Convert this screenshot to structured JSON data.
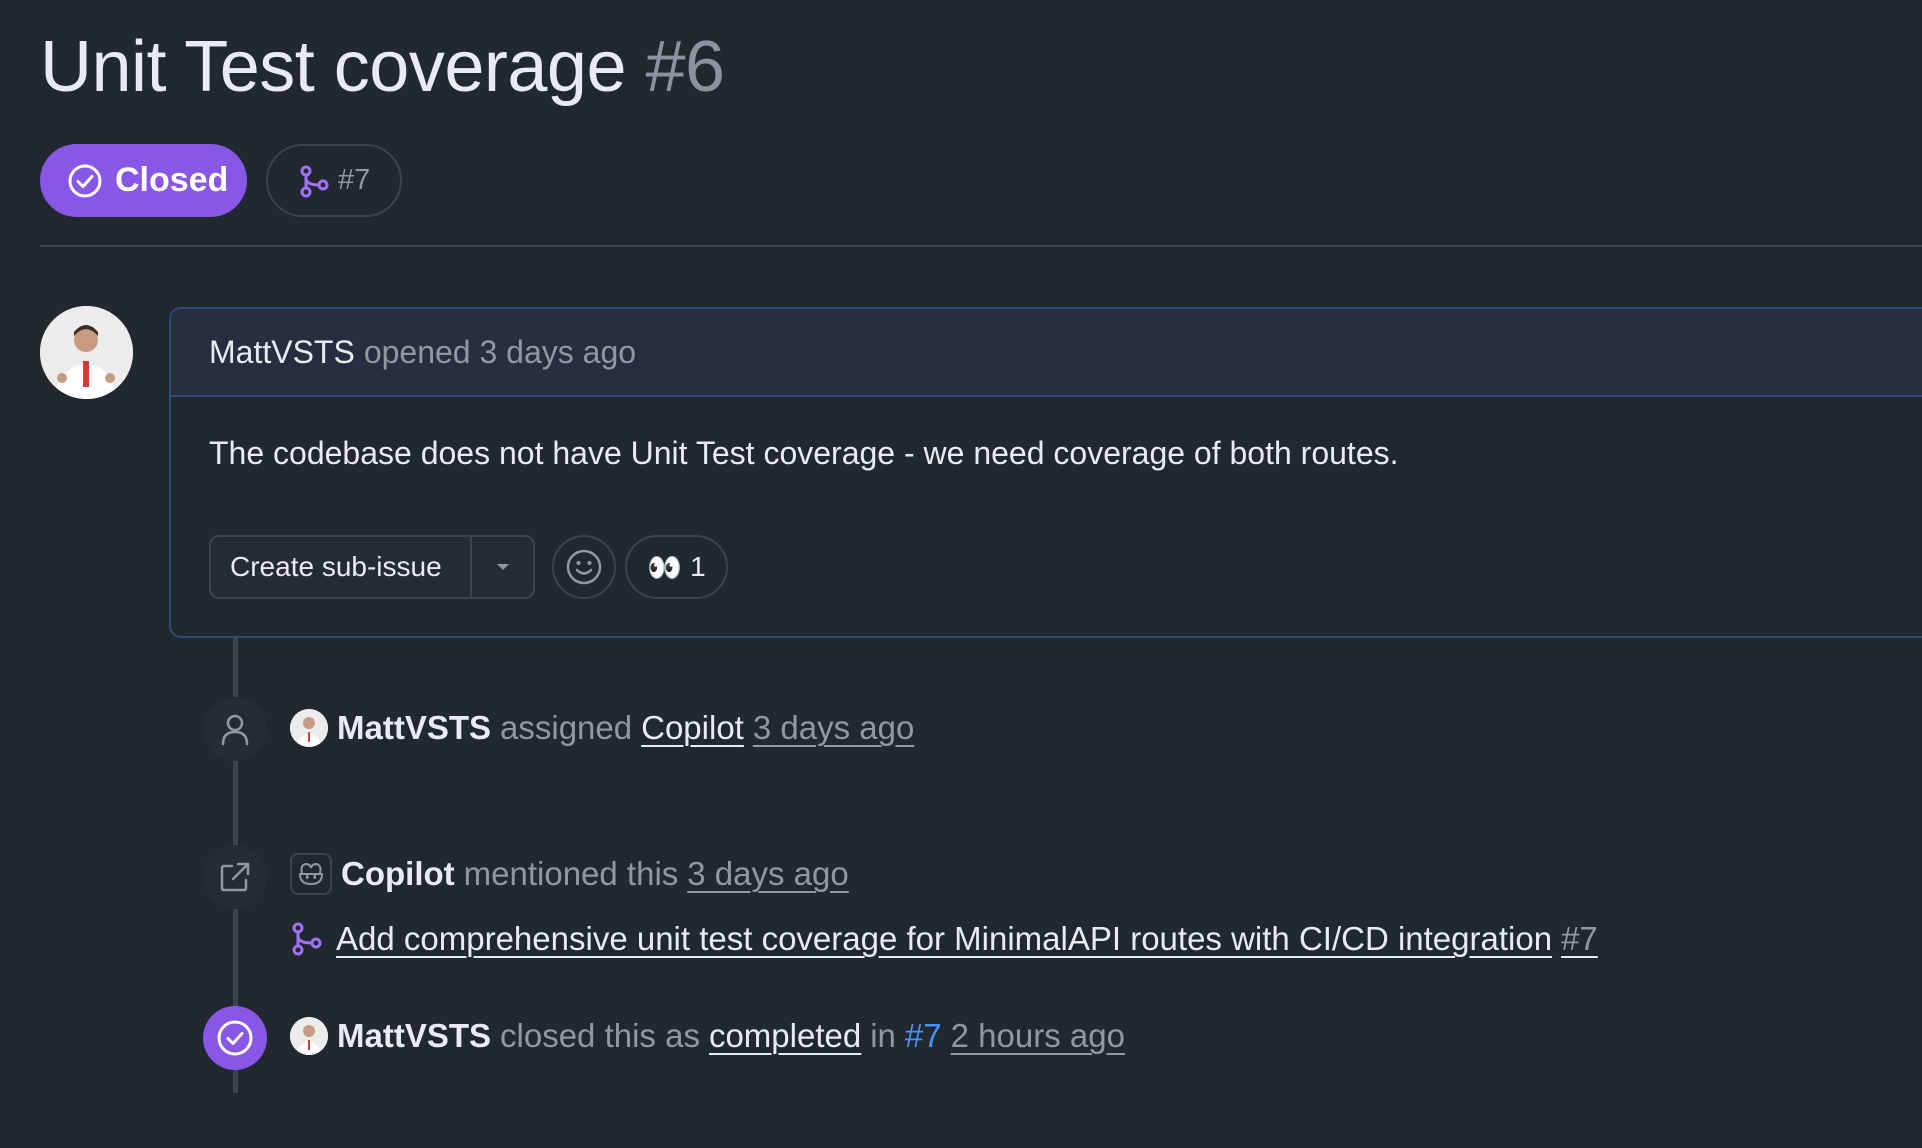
{
  "issue": {
    "title": "Unit Test coverage",
    "number": "#6",
    "state_label": "Closed",
    "linked_pr": "#7"
  },
  "comment": {
    "author": "MattVSTS",
    "opened_text": "opened 3 days ago",
    "body": "The codebase does not have Unit Test coverage - we need coverage of both routes.",
    "create_subissue_label": "Create sub-issue",
    "reaction_emoji": "👀",
    "reaction_count": "1"
  },
  "timeline": {
    "assigned": {
      "actor": "MattVSTS",
      "verb": "assigned",
      "assignee": "Copilot",
      "time": "3 days ago"
    },
    "mentioned": {
      "actor": "Copilot",
      "verb": "mentioned this",
      "time": "3 days ago",
      "ref_title": "Add comprehensive unit test coverage for MinimalAPI routes with CI/CD integration",
      "ref_number": "#7"
    },
    "closed": {
      "actor": "MattVSTS",
      "verb": "closed this as",
      "reason": "completed",
      "in_word": "in",
      "pr": "#7",
      "time": "2 hours ago"
    }
  },
  "colors": {
    "background": "#212830",
    "closed_purple": "#8957e5",
    "link_blue": "#4493f8",
    "border": "#3d444d"
  },
  "icons": [
    "check-circle-icon",
    "pull-request-icon",
    "triangle-down-icon",
    "smiley-icon",
    "person-icon",
    "cross-reference-icon",
    "copilot-icon"
  ]
}
